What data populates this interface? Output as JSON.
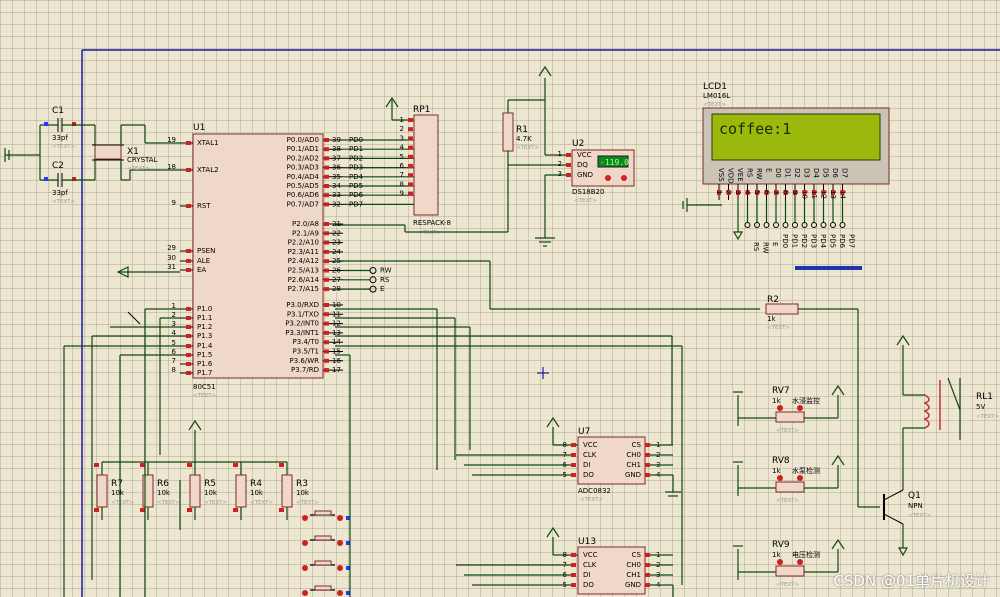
{
  "components": {
    "c1": {
      "ref": "C1",
      "value": "33pf",
      "text": "<TEXT>"
    },
    "c2": {
      "ref": "C2",
      "value": "33pf",
      "text": "<TEXT>"
    },
    "x1": {
      "ref": "X1",
      "value": "CRYSTAL",
      "text": "<TEXT>"
    },
    "u1": {
      "ref": "U1",
      "part": "80C51",
      "text": "<TEXT>",
      "left_pins": [
        {
          "num": "19",
          "name": "XTAL1"
        },
        {
          "num": "18",
          "name": "XTAL2"
        },
        {
          "num": "9",
          "name": "RST"
        },
        {
          "num": "29",
          "name": "PSEN"
        },
        {
          "num": "30",
          "name": "ALE"
        },
        {
          "num": "31",
          "name": "EA"
        },
        {
          "num": "1",
          "name": "P1.0"
        },
        {
          "num": "2",
          "name": "P1.1"
        },
        {
          "num": "3",
          "name": "P1.2"
        },
        {
          "num": "4",
          "name": "P1.3"
        },
        {
          "num": "5",
          "name": "P1.4"
        },
        {
          "num": "6",
          "name": "P1.5"
        },
        {
          "num": "7",
          "name": "P1.6"
        },
        {
          "num": "8",
          "name": "P1.7"
        }
      ],
      "right_pins": [
        {
          "num": "39",
          "name": "P0.0/AD0"
        },
        {
          "num": "38",
          "name": "P0.1/AD1"
        },
        {
          "num": "37",
          "name": "P0.2/AD2"
        },
        {
          "num": "36",
          "name": "P0.3/AD3"
        },
        {
          "num": "35",
          "name": "P0.4/AD4"
        },
        {
          "num": "34",
          "name": "P0.5/AD5"
        },
        {
          "num": "33",
          "name": "P0.6/AD6"
        },
        {
          "num": "32",
          "name": "P0.7/AD7"
        },
        {
          "num": "21",
          "name": "P2.0/A8"
        },
        {
          "num": "22",
          "name": "P2.1/A9"
        },
        {
          "num": "23",
          "name": "P2.2/A10"
        },
        {
          "num": "24",
          "name": "P2.3/A11"
        },
        {
          "num": "25",
          "name": "P2.4/A12"
        },
        {
          "num": "26",
          "name": "P2.5/A13"
        },
        {
          "num": "27",
          "name": "P2.6/A14"
        },
        {
          "num": "28",
          "name": "P2.7/A15"
        },
        {
          "num": "10",
          "name": "P3.0/RXD"
        },
        {
          "num": "11",
          "name": "P3.1/TXD"
        },
        {
          "num": "12",
          "name": "P3.2/INT0"
        },
        {
          "num": "13",
          "name": "P3.3/INT1"
        },
        {
          "num": "14",
          "name": "P3.4/T0"
        },
        {
          "num": "15",
          "name": "P3.5/T1"
        },
        {
          "num": "16",
          "name": "P3.6/WR"
        },
        {
          "num": "17",
          "name": "P3.7/RD"
        }
      ],
      "p0_nets": [
        "PD0",
        "PD1",
        "PD2",
        "PD3",
        "PD4",
        "PD5",
        "PD6",
        "PD7"
      ],
      "p2_nets": [
        "RW",
        "RS",
        "E"
      ]
    },
    "rp1": {
      "ref": "RP1",
      "part": "RESPACK-8",
      "text": "<TEXT>",
      "pins": [
        "1",
        "2",
        "3",
        "4",
        "5",
        "6",
        "7",
        "8",
        "9"
      ]
    },
    "r1": {
      "ref": "R1",
      "value": "4.7K",
      "text": "<TEXT>"
    },
    "u2": {
      "ref": "U2",
      "part": "DS18B20",
      "text": "<TEXT>",
      "display": "-119.0",
      "pins": [
        {
          "num": "1",
          "name": "VCC"
        },
        {
          "num": "2",
          "name": "DQ"
        },
        {
          "num": "3",
          "name": "GND"
        }
      ]
    },
    "lcd1": {
      "ref": "LCD1",
      "part": "LM016L",
      "text": "<TEXT>",
      "screen": "coffee:1",
      "pins": [
        "VSS",
        "VDD",
        "VEE",
        "RS",
        "RW",
        "E",
        "D0",
        "D1",
        "D2",
        "D3",
        "D4",
        "D5",
        "D6",
        "D7"
      ],
      "pin_nums": [
        "1",
        "2",
        "3",
        "4",
        "5",
        "6",
        "7",
        "8",
        "9",
        "10",
        "11",
        "12",
        "13",
        "14"
      ],
      "ctrl_nets": [
        "RS",
        "RW",
        "E"
      ],
      "data_nets": [
        "PD0",
        "PD1",
        "PD2",
        "PD3",
        "PD4",
        "PD5",
        "PD6",
        "PD7"
      ]
    },
    "r2": {
      "ref": "R2",
      "value": "1k",
      "text": "<TEXT>"
    },
    "rl1": {
      "ref": "RL1",
      "value": "5V",
      "text": "<TEXT>"
    },
    "q1": {
      "ref": "Q1",
      "part": "NPN",
      "text": "<TEXT>"
    },
    "rv7": {
      "ref": "RV7",
      "value": "1k",
      "label": "水浸监控",
      "text": "<TEXT>"
    },
    "rv8": {
      "ref": "RV8",
      "value": "1k",
      "label": "水泵检测",
      "text": "<TEXT>"
    },
    "rv9": {
      "ref": "RV9",
      "value": "1k",
      "label": "电压检测",
      "text": "<TEXT>"
    },
    "u7": {
      "ref": "U7",
      "part": "ADC0832",
      "text": "<TEXT>",
      "left_pins": [
        {
          "num": "8",
          "name": "VCC"
        },
        {
          "num": "7",
          "name": "CLK"
        },
        {
          "num": "6",
          "name": "DI"
        },
        {
          "num": "5",
          "name": "DO"
        }
      ],
      "right_pins": [
        {
          "num": "1",
          "name": "CS"
        },
        {
          "num": "2",
          "name": "CH0"
        },
        {
          "num": "3",
          "name": "CH1"
        },
        {
          "num": "4",
          "name": "GND"
        }
      ]
    },
    "u13": {
      "ref": "U13",
      "part": "ADC0832",
      "left_pins": [
        {
          "num": "8",
          "name": "VCC"
        },
        {
          "num": "7",
          "name": "CLK"
        },
        {
          "num": "6",
          "name": "DI"
        },
        {
          "num": "5",
          "name": "DO"
        }
      ],
      "right_pins": [
        {
          "num": "1",
          "name": "CS"
        },
        {
          "num": "2",
          "name": "CH0"
        },
        {
          "num": "3",
          "name": "CH1"
        },
        {
          "num": "4",
          "name": "GND"
        }
      ]
    },
    "resistors": [
      {
        "ref": "R7",
        "value": "10k",
        "text": "<TEXT>"
      },
      {
        "ref": "R6",
        "value": "10k",
        "text": "<TEXT>"
      },
      {
        "ref": "R5",
        "value": "10k",
        "text": "<TEXT>"
      },
      {
        "ref": "R4",
        "value": "10k",
        "text": "<TEXT>"
      },
      {
        "ref": "R3",
        "value": "10k",
        "text": "<TEXT>"
      }
    ]
  },
  "watermark": "CSDN @01单片机设计",
  "colors": {
    "wire": "#0f4a0f",
    "chip_fill": "#f0d8c8",
    "chip_border": "#7a2a2a",
    "pin_red": "#d02020",
    "pin_blue": "#1a3cff",
    "lcd_screen": "#9bb80c",
    "border_blue": "#1a1aa0"
  }
}
